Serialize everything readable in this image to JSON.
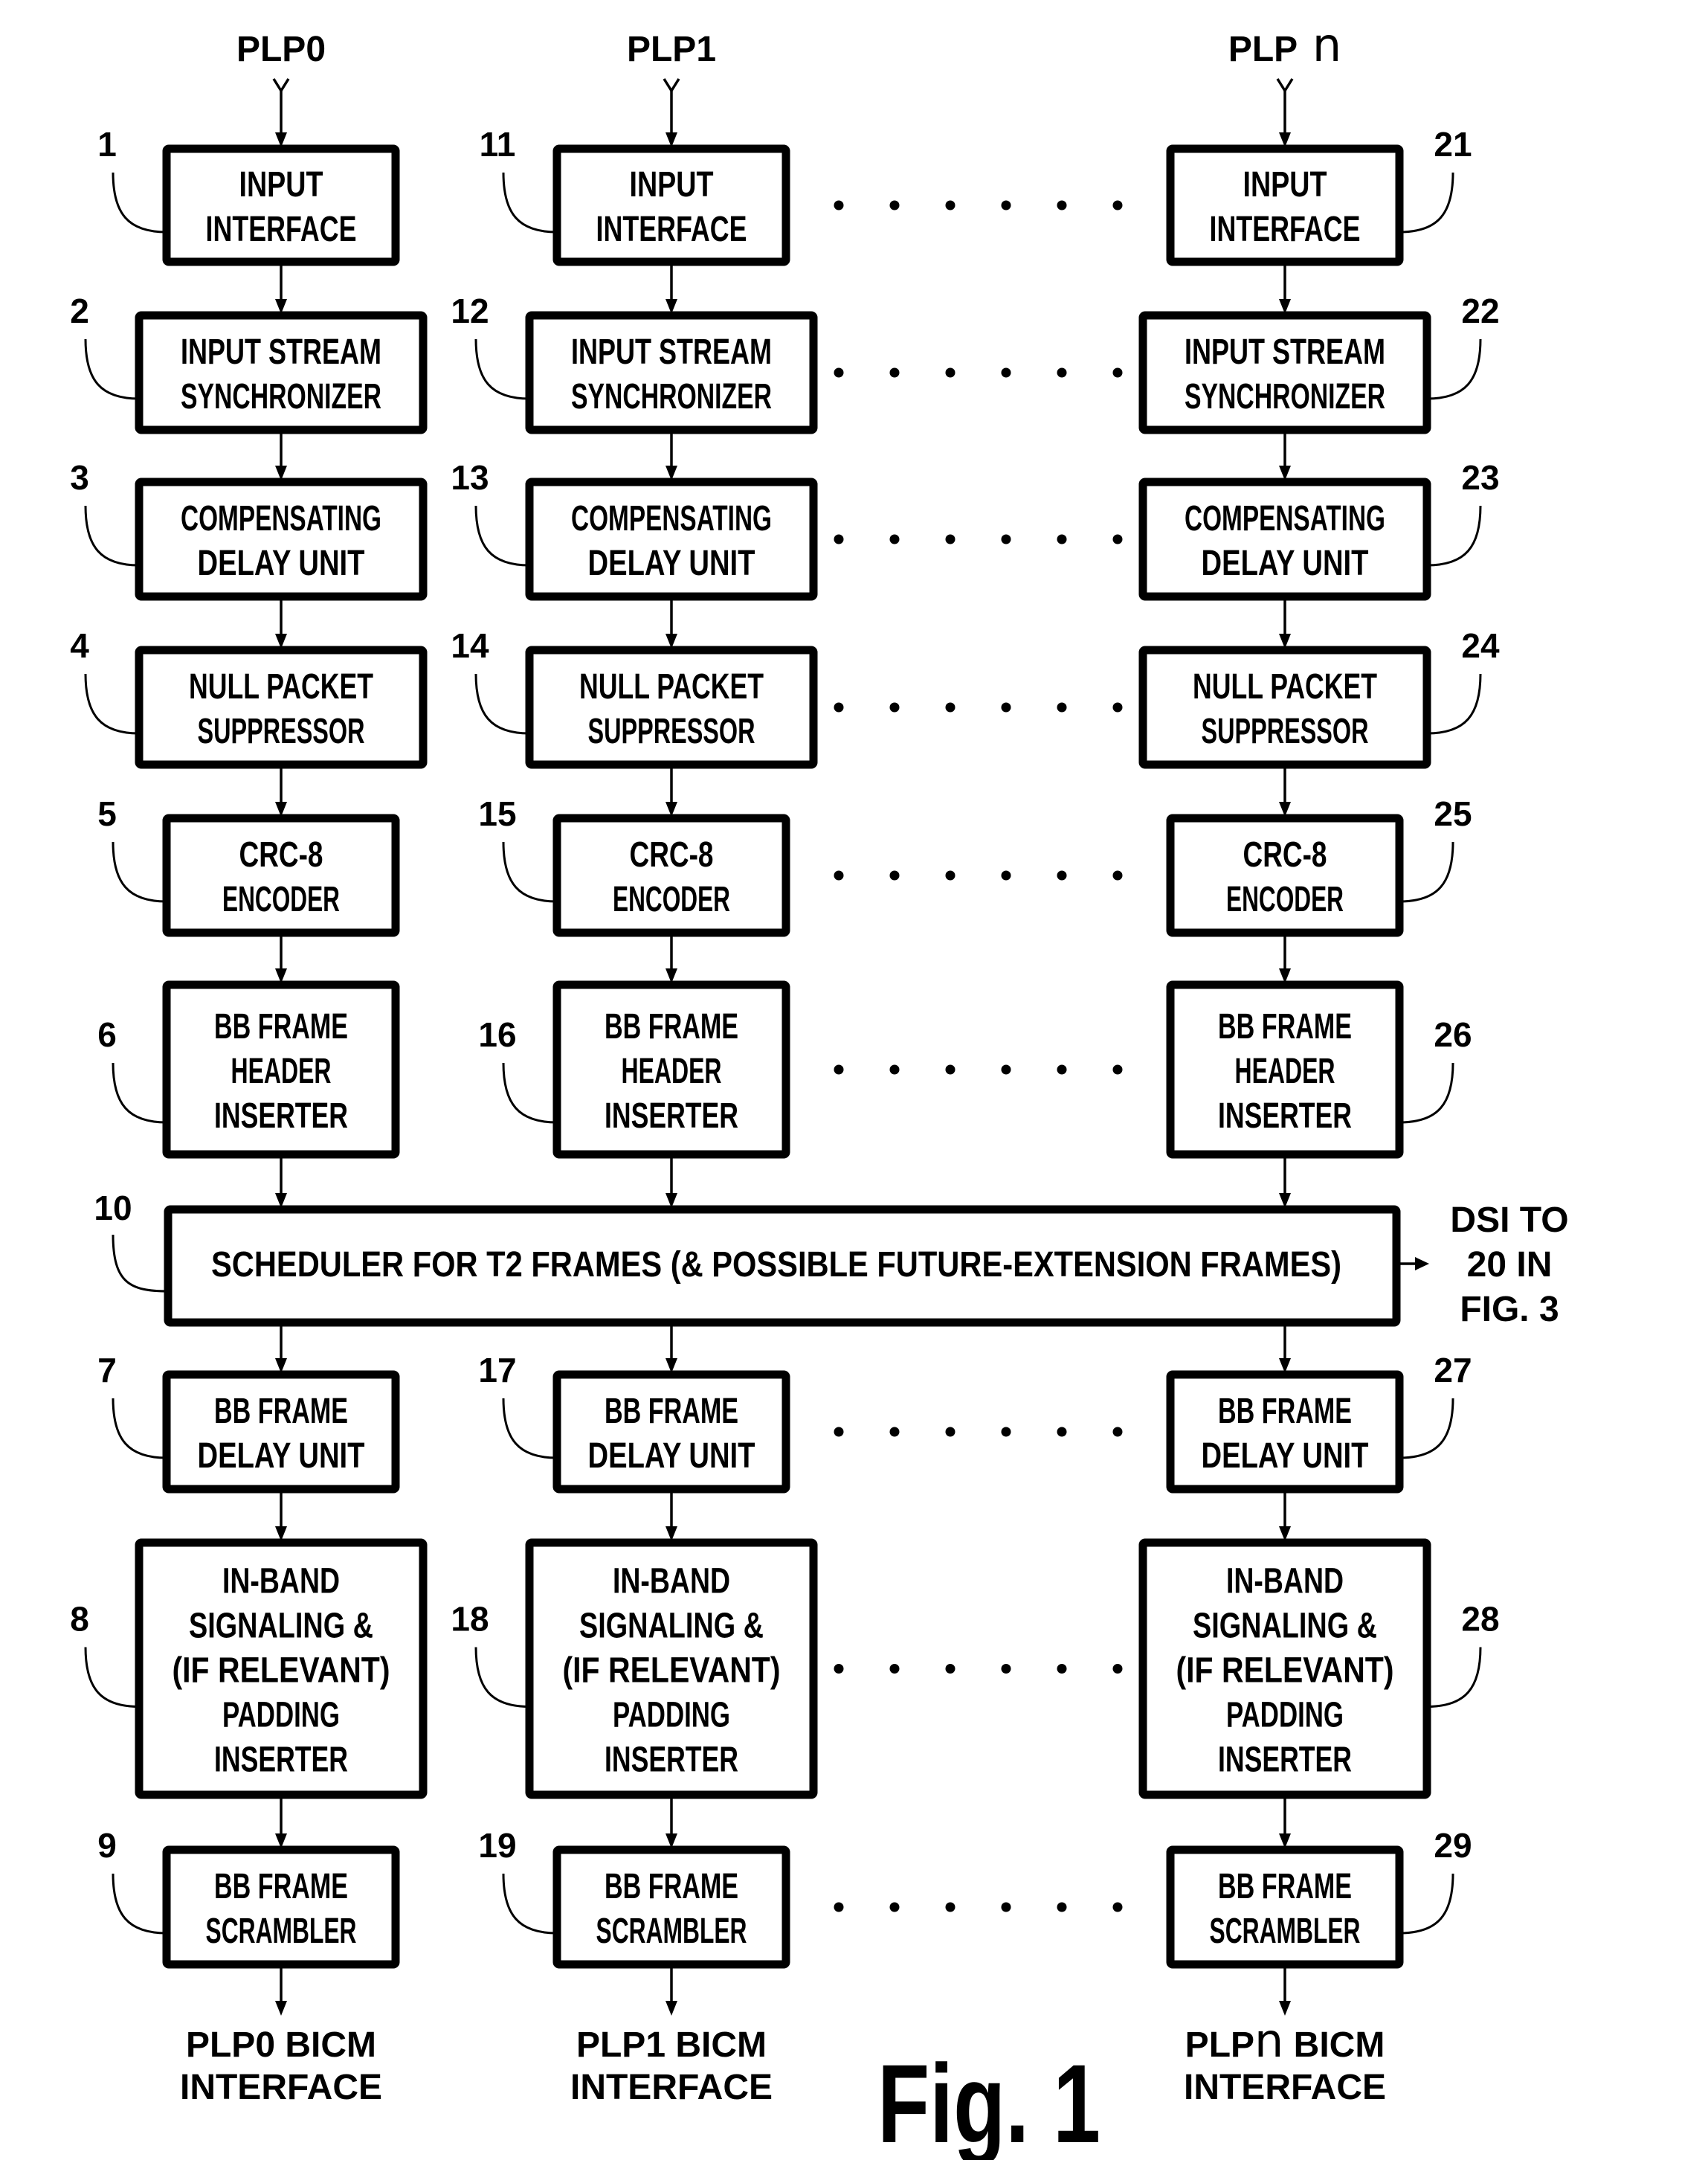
{
  "figure": {
    "caption": "Fig. 1",
    "color_ink": "#000000",
    "color_paper": "#ffffff"
  },
  "columns": [
    {
      "id": "plp0",
      "input_label": {
        "prefix": "PLP",
        "suffix": "0"
      },
      "output_label": {
        "line1_prefix": "PLP",
        "line1_var": "0",
        "line1_rest": " BICM",
        "line2": "INTERFACE"
      },
      "ref_side": "left",
      "blocks_upper": [
        {
          "ref": "1",
          "lines": [
            "INPUT",
            "INTERFACE"
          ]
        },
        {
          "ref": "2",
          "lines": [
            "INPUT STREAM",
            "SYNCHRONIZER"
          ]
        },
        {
          "ref": "3",
          "lines": [
            "COMPENSATING",
            "DELAY UNIT"
          ]
        },
        {
          "ref": "4",
          "lines": [
            "NULL PACKET",
            "SUPPRESSOR"
          ]
        },
        {
          "ref": "5",
          "lines": [
            "CRC-8",
            "ENCODER"
          ]
        },
        {
          "ref": "6",
          "lines": [
            "BB FRAME",
            "HEADER",
            "INSERTER"
          ]
        }
      ],
      "blocks_lower": [
        {
          "ref": "7",
          "lines": [
            "BB FRAME",
            "DELAY UNIT"
          ]
        },
        {
          "ref": "8",
          "lines": [
            "IN-BAND",
            "SIGNALING &",
            "(IF RELEVANT)",
            "PADDING",
            "INSERTER"
          ]
        },
        {
          "ref": "9",
          "lines": [
            "BB FRAME",
            "SCRAMBLER"
          ]
        }
      ]
    },
    {
      "id": "plp1",
      "input_label": {
        "prefix": "PLP",
        "suffix": "1"
      },
      "output_label": {
        "line1_prefix": "PLP",
        "line1_var": "1",
        "line1_rest": " BICM",
        "line2": "INTERFACE"
      },
      "ref_side": "left",
      "blocks_upper": [
        {
          "ref": "11",
          "lines": [
            "INPUT",
            "INTERFACE"
          ]
        },
        {
          "ref": "12",
          "lines": [
            "INPUT STREAM",
            "SYNCHRONIZER"
          ]
        },
        {
          "ref": "13",
          "lines": [
            "COMPENSATING",
            "DELAY UNIT"
          ]
        },
        {
          "ref": "14",
          "lines": [
            "NULL PACKET",
            "SUPPRESSOR"
          ]
        },
        {
          "ref": "15",
          "lines": [
            "CRC-8",
            "ENCODER"
          ]
        },
        {
          "ref": "16",
          "lines": [
            "BB FRAME",
            "HEADER",
            "INSERTER"
          ]
        }
      ],
      "blocks_lower": [
        {
          "ref": "17",
          "lines": [
            "BB FRAME",
            "DELAY UNIT"
          ]
        },
        {
          "ref": "18",
          "lines": [
            "IN-BAND",
            "SIGNALING &",
            "(IF RELEVANT)",
            "PADDING",
            "INSERTER"
          ]
        },
        {
          "ref": "19",
          "lines": [
            "BB FRAME",
            "SCRAMBLER"
          ]
        }
      ]
    },
    {
      "id": "plpn",
      "input_label": {
        "prefix": "PLP",
        "suffix": "n"
      },
      "output_label": {
        "line1_prefix": "PLP",
        "line1_var": "n",
        "line1_rest": " BICM",
        "line2": "INTERFACE"
      },
      "ref_side": "right",
      "blocks_upper": [
        {
          "ref": "21",
          "lines": [
            "INPUT",
            "INTERFACE"
          ]
        },
        {
          "ref": "22",
          "lines": [
            "INPUT STREAM",
            "SYNCHRONIZER"
          ]
        },
        {
          "ref": "23",
          "lines": [
            "COMPENSATING",
            "DELAY UNIT"
          ]
        },
        {
          "ref": "24",
          "lines": [
            "NULL PACKET",
            "SUPPRESSOR"
          ]
        },
        {
          "ref": "25",
          "lines": [
            "CRC-8",
            "ENCODER"
          ]
        },
        {
          "ref": "26",
          "lines": [
            "BB FRAME",
            "HEADER",
            "INSERTER"
          ]
        }
      ],
      "blocks_lower": [
        {
          "ref": "27",
          "lines": [
            "BB FRAME",
            "DELAY UNIT"
          ]
        },
        {
          "ref": "28",
          "lines": [
            "IN-BAND",
            "SIGNALING &",
            "(IF RELEVANT)",
            "PADDING",
            "INSERTER"
          ]
        },
        {
          "ref": "29",
          "lines": [
            "BB FRAME",
            "SCRAMBLER"
          ]
        }
      ]
    }
  ],
  "scheduler": {
    "ref": "10",
    "label": "SCHEDULER FOR T2 FRAMES (& POSSIBLE FUTURE-EXTENSION FRAMES)",
    "output_label_lines": [
      "DSI TO",
      "20 IN",
      "FIG. 3"
    ]
  },
  "ellipsis": {
    "dot_count": 6,
    "rows_with_ellipsis": 9
  }
}
